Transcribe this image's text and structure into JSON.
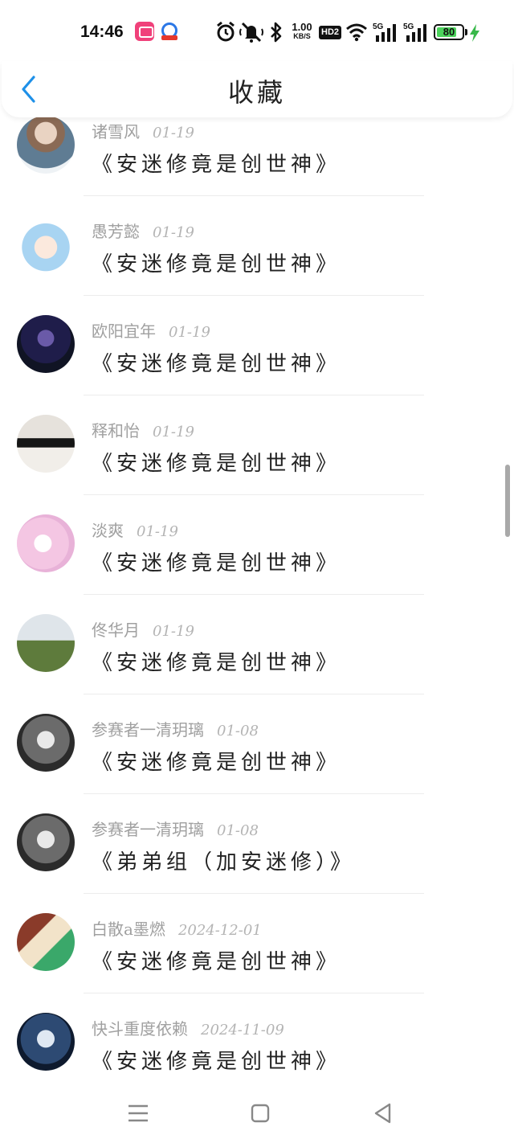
{
  "status_bar": {
    "time": "14:46",
    "net_speed_value": "1.00",
    "net_speed_unit": "KB/S",
    "hd_badge": "HD2",
    "sim1_label": "5G",
    "sim2_label": "5G",
    "battery_percent": "80",
    "battery_level": 0.8,
    "icons": [
      "bilibili-app-icon",
      "app-icon",
      "alarm-icon",
      "mute-icon",
      "bluetooth-icon",
      "wifi-icon",
      "signal-icon",
      "signal-icon",
      "battery-icon",
      "charging-icon"
    ]
  },
  "header": {
    "title": "收藏",
    "back_icon": "chevron-left-icon",
    "accent": "#1e90e8"
  },
  "favorites": [
    {
      "author": "诸雪风",
      "date": "01-19",
      "title": "《安迷修竟是创世神》"
    },
    {
      "author": "愚芳懿",
      "date": "01-19",
      "title": "《安迷修竟是创世神》"
    },
    {
      "author": "欧阳宜年",
      "date": "01-19",
      "title": "《安迷修竟是创世神》"
    },
    {
      "author": "释和怡",
      "date": "01-19",
      "title": "《安迷修竟是创世神》"
    },
    {
      "author": "淡爽",
      "date": "01-19",
      "title": "《安迷修竟是创世神》"
    },
    {
      "author": "佟华月",
      "date": "01-19",
      "title": "《安迷修竟是创世神》"
    },
    {
      "author": "参赛者一清玥璃",
      "date": "01-08",
      "title": "《安迷修竟是创世神》"
    },
    {
      "author": "参赛者一清玥璃",
      "date": "01-08",
      "title": "《弟弟组（加安迷修）》"
    },
    {
      "author": "白散a墨燃",
      "date": "2024-12-01",
      "title": "《安迷修竟是创世神》"
    },
    {
      "author": "快斗重度依赖",
      "date": "2024-11-09",
      "title": "《安迷修竟是创世神》"
    }
  ],
  "nav_bar": {
    "icons": [
      "menu-icon",
      "home-icon",
      "back-triangle-icon"
    ]
  }
}
